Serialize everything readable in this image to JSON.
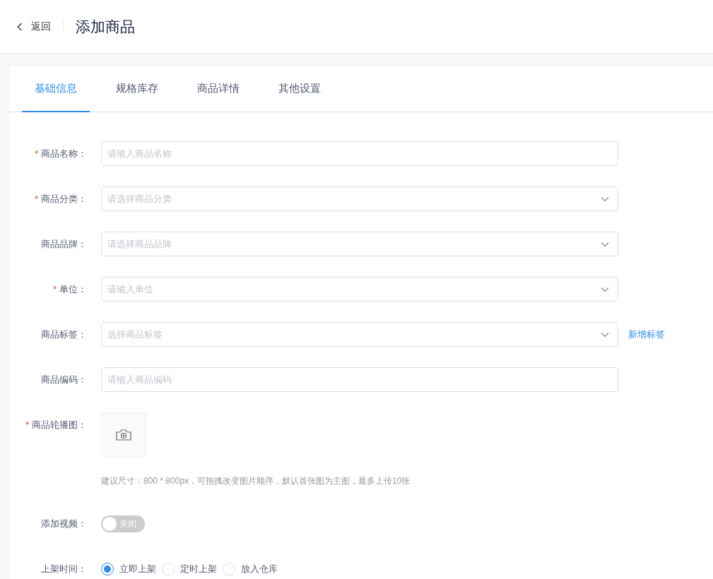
{
  "header": {
    "back": "返回",
    "title": "添加商品"
  },
  "tabs": [
    {
      "label": "基础信息",
      "selected": true
    },
    {
      "label": "规格库存",
      "selected": false
    },
    {
      "label": "商品详情",
      "selected": false
    },
    {
      "label": "其他设置",
      "selected": false
    }
  ],
  "fields": [
    {
      "kind": "input",
      "label": "商品名称：",
      "required_mark": "*",
      "placeholder": "请输入商品名称"
    },
    {
      "kind": "select",
      "label": "商品分类：",
      "required_mark": "*",
      "placeholder": "请选择商品分类"
    },
    {
      "kind": "select",
      "label": "商品品牌：",
      "placeholder": "请选择商品品牌"
    },
    {
      "kind": "select",
      "label": "单位：",
      "required_mark": "*",
      "placeholder": "请输入单位"
    },
    {
      "kind": "select",
      "label": "商品标签：",
      "placeholder": "选择商品标签",
      "link": "新增标签"
    },
    {
      "kind": "input",
      "label": "商品编码：",
      "placeholder": "请输入商品编码"
    },
    {
      "kind": "upload",
      "label": "商品轮播图：",
      "required_mark": "*",
      "hint": "建议尺寸：800 * 800px，可拖拽改变图片顺序，默认首张图为主图，最多上传10张"
    },
    {
      "kind": "switch",
      "label": "添加视频：",
      "on": false,
      "text": "关闭"
    },
    {
      "kind": "radio",
      "label": "上架时间：",
      "options": [
        {
          "label": "立即上架",
          "selected": true
        },
        {
          "label": "定时上架",
          "selected": false
        },
        {
          "label": "放入仓库",
          "selected": false
        }
      ]
    }
  ]
}
